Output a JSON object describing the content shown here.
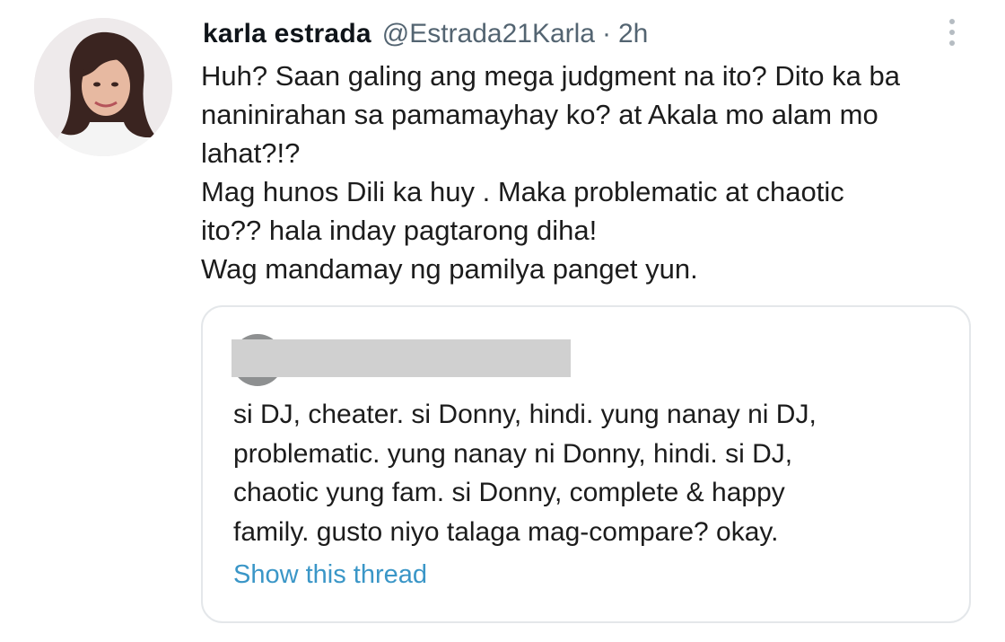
{
  "tweet": {
    "author": {
      "display_name": "karla estrada",
      "handle": "@Estrada21Karla",
      "separator": "·",
      "time": "2h"
    },
    "text_lines": [
      "Huh? Saan galing ang mega judgment na ito? Dito ka ba",
      "naninirahan sa pamamayhay ko? at Akala mo alam mo",
      "lahat?!?",
      "Mag hunos Dili ka huy .  Maka problematic at chaotic",
      "ito?? hala inday pagtarong diha!",
      "Wag mandamay ng pamilya  panget yun."
    ],
    "more_icon": "more-vertical-icon"
  },
  "quoted_tweet": {
    "text_lines": [
      "si DJ, cheater. si Donny, hindi. yung nanay ni DJ,",
      "problematic. yung nanay ni Donny, hindi. si DJ,",
      "chaotic yung fam. si Donny, complete & happy",
      "family. gusto niyo talaga mag-compare? okay."
    ],
    "show_thread_label": "Show this thread",
    "link_color": "#3a96c7"
  }
}
